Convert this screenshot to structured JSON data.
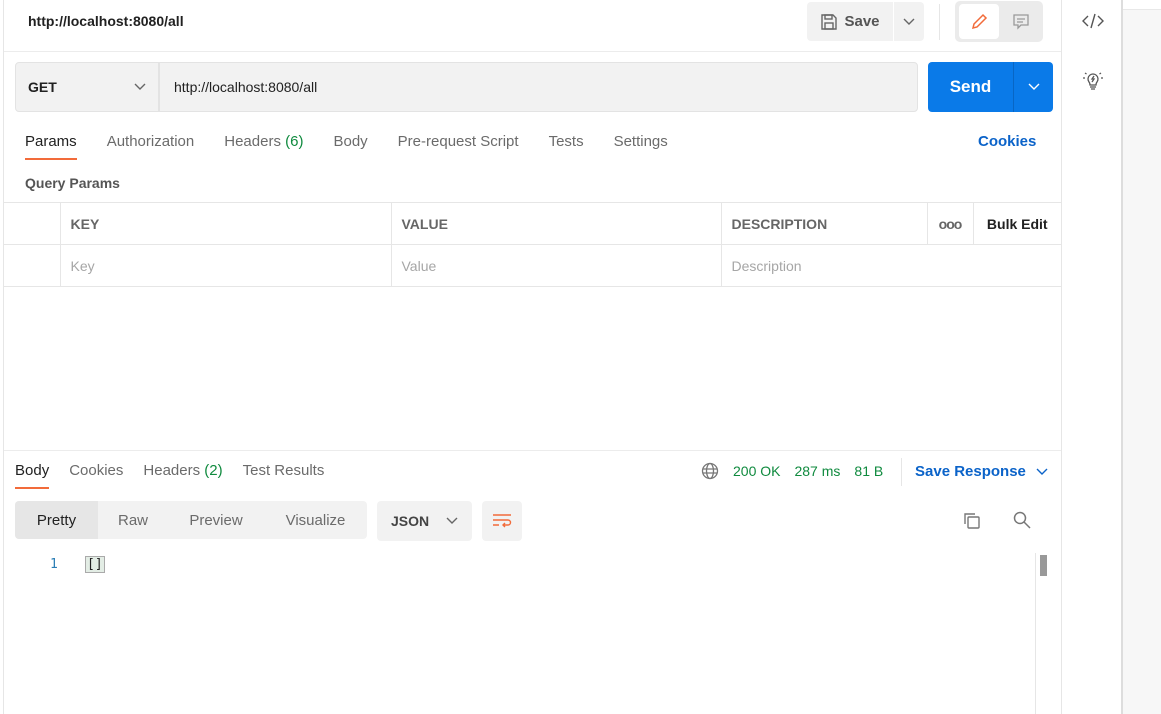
{
  "header": {
    "title": "http://localhost:8080/all",
    "save_label": "Save"
  },
  "request": {
    "method": "GET",
    "url": "http://localhost:8080/all",
    "send_label": "Send"
  },
  "tabs": [
    {
      "label": "Params",
      "active": true
    },
    {
      "label": "Authorization"
    },
    {
      "label": "Headers",
      "count": "(6)"
    },
    {
      "label": "Body"
    },
    {
      "label": "Pre-request Script"
    },
    {
      "label": "Tests"
    },
    {
      "label": "Settings"
    }
  ],
  "cookies_label": "Cookies",
  "query_params": {
    "title": "Query Params",
    "columns": [
      "KEY",
      "VALUE",
      "DESCRIPTION"
    ],
    "more": "ooo",
    "bulk_edit": "Bulk Edit",
    "placeholders": [
      "Key",
      "Value",
      "Description"
    ]
  },
  "response": {
    "tabs": [
      {
        "label": "Body",
        "active": true
      },
      {
        "label": "Cookies"
      },
      {
        "label": "Headers",
        "count": "(2)"
      },
      {
        "label": "Test Results"
      }
    ],
    "status": "200 OK",
    "time": "287 ms",
    "size": "81 B",
    "save_label": "Save Response",
    "formats": [
      "Pretty",
      "Raw",
      "Preview",
      "Visualize"
    ],
    "language": "JSON",
    "lines": [
      {
        "number": "1",
        "text": "[]"
      }
    ]
  },
  "colors": {
    "accent": "#f26b3a",
    "send": "#0a7ae8",
    "link": "#0b63c9",
    "status": "#0f8a3e"
  }
}
